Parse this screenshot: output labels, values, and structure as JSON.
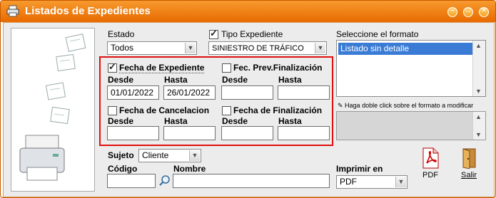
{
  "window": {
    "title": "Listados de Expedientes"
  },
  "titlebar_buttons": {
    "minimize": "–",
    "maximize": "□",
    "close": "×"
  },
  "estado": {
    "label": "Estado",
    "value": "Todos"
  },
  "tipo_expediente": {
    "label": "Tipo Expediente",
    "checked": true,
    "value": "SINIESTRO DE TRÁFICO"
  },
  "formato": {
    "label": "Seleccione el formato",
    "options": [
      "Listado sin detalle"
    ],
    "selected": "Listado sin detalle",
    "hint": "Haga doble click sobre el formato a modificar"
  },
  "fecha_expediente": {
    "label": "Fecha de Expediente",
    "checked": true,
    "desde_label": "Desde",
    "hasta_label": "Hasta",
    "desde": "01/01/2022",
    "hasta": "26/01/2022"
  },
  "fec_prev_finalizacion": {
    "label": "Fec. Prev.Finalización",
    "checked": false,
    "desde_label": "Desde",
    "hasta_label": "Hasta",
    "desde": "",
    "hasta": ""
  },
  "fecha_cancelacion": {
    "label": "Fecha de Cancelacion",
    "checked": false,
    "desde_label": "Desde",
    "hasta_label": "Hasta",
    "desde": "",
    "hasta": ""
  },
  "fecha_finalizacion": {
    "label": "Fecha de Finalización",
    "checked": false,
    "desde_label": "Desde",
    "hasta_label": "Hasta",
    "desde": "",
    "hasta": ""
  },
  "sujeto": {
    "label": "Sujeto",
    "value": "Cliente"
  },
  "codigo": {
    "label": "Código",
    "value": ""
  },
  "nombre": {
    "label": "Nombre",
    "value": ""
  },
  "imprimir": {
    "label": "Imprimir en",
    "value": "PDF"
  },
  "actions": {
    "pdf": "PDF",
    "salir": "Salir"
  },
  "colors": {
    "title_bar": "#f08a1c",
    "highlight_box": "#e01010",
    "list_selection": "#3a7bd5"
  }
}
